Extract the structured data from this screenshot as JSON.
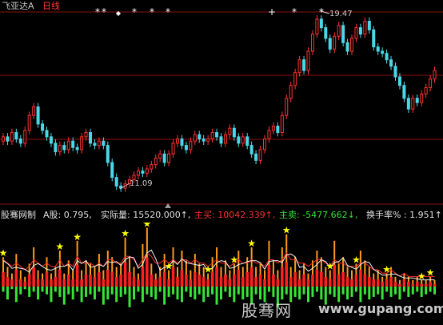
{
  "header": {
    "stock_name": "飞亚达A",
    "period": "日线"
  },
  "price_panel": {
    "high_label": "19.47",
    "low_label": "11.09"
  },
  "indicator_bar": {
    "name": "股骞网制",
    "a_share_label": "A股: 0.795,",
    "actual_volume_label": "实际量: 15520.000↑,",
    "main_buy_label": "主买: 10042.339↑,",
    "main_sell_label": "主卖: -5477.662↓,",
    "turnover_label": "换手率% : 1.951↑"
  },
  "watermark": {
    "site_name": "股骞网",
    "url": "www.gupang.com"
  },
  "colors": {
    "background": "#000000",
    "up": "#ff3232",
    "down": "#4ad7e8",
    "grid": "#8a1010",
    "vol_green": "#35e635",
    "vol_red": "#ff2020",
    "vol_orange": "#ff9a1a",
    "star": "#ffff00"
  },
  "chart_data": [
    {
      "type": "candlestick",
      "title": "飞亚达A 日线",
      "annotations": [
        {
          "text": "19.47",
          "kind": "high"
        },
        {
          "text": "11.09",
          "kind": "low"
        }
      ],
      "close": [
        13.6,
        13.4,
        13.8,
        13.5,
        13.3,
        13.9,
        14.6,
        15.0,
        14.2,
        13.9,
        13.6,
        13.3,
        12.9,
        13.2,
        13.0,
        13.4,
        13.1,
        13.0,
        13.6,
        13.8,
        13.3,
        13.2,
        13.4,
        13.2,
        12.4,
        11.7,
        11.3,
        11.2,
        11.4,
        11.6,
        11.8,
        12.0,
        11.9,
        12.1,
        12.3,
        12.6,
        12.8,
        12.4,
        12.8,
        13.3,
        13.5,
        13.2,
        13.0,
        13.4,
        13.7,
        13.5,
        13.4,
        13.5,
        13.8,
        13.6,
        13.3,
        13.7,
        14.0,
        13.6,
        13.3,
        13.6,
        13.2,
        12.8,
        12.5,
        13.0,
        13.5,
        13.9,
        14.1,
        13.8,
        14.6,
        15.4,
        16.0,
        16.6,
        17.2,
        16.7,
        17.6,
        18.4,
        19.1,
        18.7,
        18.2,
        17.7,
        18.3,
        18.8,
        18.0,
        17.6,
        18.2,
        18.7,
        18.4,
        19.0,
        18.6,
        17.8,
        17.6,
        17.5,
        17.2,
        16.9,
        16.4,
        16.0,
        15.4,
        14.9,
        15.4,
        15.2,
        15.6,
        15.9,
        16.3,
        16.7
      ]
    },
    {
      "type": "bar",
      "title": "股骞网制",
      "series": [
        {
          "name": "实际量",
          "values": [
            9,
            6,
            4,
            10,
            5,
            3,
            7,
            12,
            5,
            4,
            9,
            4,
            6,
            11,
            4,
            8,
            5,
            14,
            5,
            8,
            7,
            6,
            10,
            5,
            11,
            9,
            6,
            7,
            15,
            9,
            6,
            4,
            13,
            18,
            7,
            4,
            6,
            10,
            5,
            12,
            6,
            11,
            8,
            5,
            10,
            7,
            6,
            4,
            9,
            12,
            6,
            8,
            5,
            7,
            11,
            6,
            9,
            12,
            6,
            7,
            5,
            14,
            8,
            5,
            12,
            16,
            6,
            9,
            5,
            7,
            4,
            8,
            11,
            9,
            6,
            5,
            14,
            7,
            9,
            6,
            5,
            7,
            11,
            8,
            6,
            4,
            5,
            3,
            4,
            6,
            3,
            2,
            4,
            3,
            2,
            3,
            2,
            2,
            3,
            2
          ]
        },
        {
          "name": "主买",
          "values": [
            6,
            4,
            3,
            7,
            3,
            2,
            5,
            8,
            3,
            3,
            6,
            3,
            4,
            7,
            3,
            5,
            3,
            9,
            3,
            5,
            5,
            4,
            6,
            3,
            7,
            6,
            4,
            5,
            10,
            6,
            4,
            3,
            8,
            12,
            5,
            3,
            4,
            6,
            3,
            8,
            4,
            7,
            5,
            3,
            6,
            5,
            4,
            3,
            6,
            8,
            4,
            5,
            3,
            5,
            7,
            4,
            6,
            8,
            4,
            5,
            3,
            9,
            5,
            3,
            8,
            10,
            4,
            6,
            3,
            5,
            3,
            5,
            7,
            6,
            4,
            3,
            9,
            5,
            6,
            4,
            3,
            5,
            7,
            5,
            4,
            3,
            3,
            2,
            3,
            4,
            2,
            1,
            3,
            2,
            1,
            2,
            1,
            1,
            2,
            1
          ]
        },
        {
          "name": "主卖",
          "values": [
            -2,
            -5,
            -1,
            -6,
            -3,
            -1,
            -4,
            -2,
            -5,
            -2,
            -3,
            -6,
            -2,
            -4,
            -7,
            -3,
            -5,
            -2,
            -6,
            -4,
            -3,
            -5,
            -2,
            -7,
            -5,
            -3,
            -6,
            -4,
            -3,
            -8,
            -5,
            -2,
            -6,
            -3,
            -4,
            -5,
            -2,
            -7,
            -4,
            -3,
            -5,
            -6,
            -2,
            -4,
            -5,
            -3,
            -6,
            -4,
            -3,
            -7,
            -5,
            -2,
            -4,
            -6,
            -3,
            -5,
            -4,
            -7,
            -3,
            -5,
            -6,
            -2,
            -4,
            -8,
            -5,
            -3,
            -6,
            -4,
            -5,
            -3,
            -6,
            -4,
            -2,
            -5,
            -7,
            -3,
            -4,
            -6,
            -3,
            -5,
            -4,
            -2,
            -6,
            -3,
            -5,
            -4,
            -3,
            -5,
            -2,
            -4,
            -3,
            -5,
            -2,
            -4,
            -3,
            -2,
            -4,
            -3,
            -2,
            -3
          ]
        },
        {
          "name": "换手率%",
          "values": [
            8,
            7,
            6,
            7,
            6,
            5,
            6,
            8,
            7,
            6,
            7,
            6,
            6,
            8,
            6,
            7,
            6,
            9,
            7,
            7,
            7,
            6,
            7,
            6,
            8,
            8,
            7,
            7,
            9,
            9,
            8,
            6,
            8,
            10,
            9,
            7,
            7,
            8,
            7,
            8,
            7,
            8,
            8,
            7,
            8,
            7,
            7,
            6,
            7,
            8,
            7,
            7,
            6,
            7,
            8,
            7,
            7,
            8,
            7,
            7,
            6,
            8,
            8,
            7,
            8,
            10,
            8,
            8,
            7,
            7,
            6,
            7,
            8,
            8,
            7,
            6,
            8,
            7,
            7,
            6,
            6,
            6,
            7,
            7,
            6,
            5,
            5,
            4,
            4,
            5,
            4,
            3,
            4,
            3,
            3,
            3,
            3,
            3,
            3,
            3
          ]
        }
      ]
    }
  ]
}
